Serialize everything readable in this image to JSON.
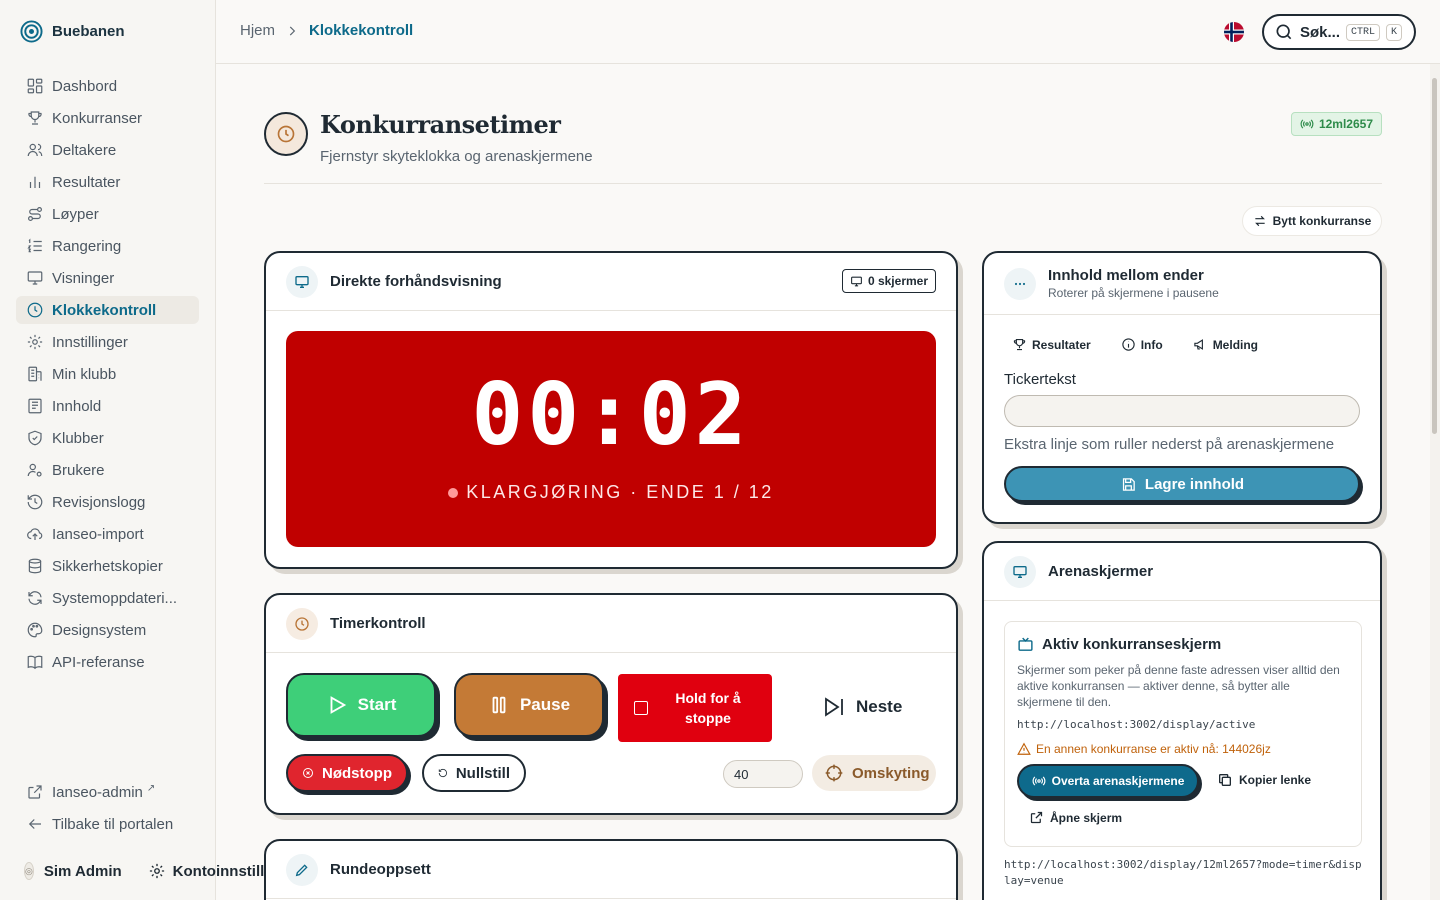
{
  "brand": {
    "name": "Buebanen"
  },
  "nav": {
    "items": [
      {
        "label": "Dashbord",
        "icon": "dashboard-icon"
      },
      {
        "label": "Konkurranser",
        "icon": "trophy-icon"
      },
      {
        "label": "Deltakere",
        "icon": "users-icon"
      },
      {
        "label": "Resultater",
        "icon": "bar-chart-icon"
      },
      {
        "label": "Løyper",
        "icon": "route-icon"
      },
      {
        "label": "Rangering",
        "icon": "list-ordered-icon"
      },
      {
        "label": "Visninger",
        "icon": "monitor-icon"
      },
      {
        "label": "Klokkekontroll",
        "icon": "clock-icon"
      },
      {
        "label": "Innstillinger",
        "icon": "gear-icon"
      },
      {
        "label": "Min klubb",
        "icon": "building-icon"
      },
      {
        "label": "Innhold",
        "icon": "newspaper-icon"
      },
      {
        "label": "Klubber",
        "icon": "shield-icon"
      },
      {
        "label": "Brukere",
        "icon": "user-gear-icon"
      },
      {
        "label": "Revisjonslogg",
        "icon": "history-icon"
      },
      {
        "label": "Ianseo-import",
        "icon": "cloud-upload-icon"
      },
      {
        "label": "Sikkerhetskopier",
        "icon": "database-icon"
      },
      {
        "label": "Systemoppdateri...",
        "icon": "refresh-icon"
      },
      {
        "label": "Designsystem",
        "icon": "palette-icon"
      },
      {
        "label": "API-referanse",
        "icon": "book-icon"
      }
    ],
    "active": "Klokkekontroll",
    "bottom": [
      {
        "label": "Ianseo-admin",
        "icon": "external-link-icon"
      },
      {
        "label": "Tilbake til portalen",
        "icon": "arrow-left-icon"
      }
    ]
  },
  "user": {
    "name": "Sim Admin",
    "account_label": "Kontoinnstilli"
  },
  "breadcrumb": {
    "home": "Hjem",
    "current": "Klokkekontroll"
  },
  "search": {
    "label": "Søk...",
    "kbd1": "CTRL",
    "kbd2": "K"
  },
  "page": {
    "title": "Konkurransetimer",
    "subtitle": "Fjernstyr skyteklokka og arenaskjermene",
    "competition_code": "12ml2657",
    "switch_button": "Bytt konkurranse"
  },
  "preview": {
    "title": "Direkte forhåndsvisning",
    "screens_badge": "0 skjermer",
    "time": "00:02",
    "phase": "KLARGJØRING · ENDE 1 / 12"
  },
  "timer": {
    "title": "Timerkontroll",
    "start": "Start",
    "pause": "Pause",
    "hold_stop_line1": "Hold for å",
    "hold_stop_line2": "stoppe",
    "next": "Neste",
    "emergency_stop": "Nødstopp",
    "reset": "Nullstill",
    "seconds_value": "40",
    "reshoot": "Omskyting"
  },
  "round_setup": {
    "title": "Rundeoppsett"
  },
  "between_ends": {
    "title": "Innhold mellom ender",
    "subtitle": "Roterer på skjermene i pausene",
    "tabs": [
      {
        "label": "Resultater",
        "icon": "trophy-icon"
      },
      {
        "label": "Info",
        "icon": "info-icon"
      },
      {
        "label": "Melding",
        "icon": "megaphone-icon"
      }
    ],
    "ticker_label": "Tickertekst",
    "ticker_value": "",
    "ticker_hint": "Ekstra linje som ruller nederst på arenaskjermene",
    "save_button": "Lagre innhold"
  },
  "arena": {
    "title": "Arenaskjermer",
    "active_title": "Aktiv konkurranseskjerm",
    "active_desc": "Skjermer som peker på denne faste adressen viser alltid den aktive konkurransen — aktiver denne, så bytter alle skjermene til den.",
    "active_url": "http://localhost:3002/display/active",
    "warning": "En annen konkurranse er aktiv nå: 144026jz",
    "takeover_button": "Overta arenaskjermene",
    "copy_link": "Kopier lenke",
    "open_screen": "Åpne skjerm",
    "venue_url": "http://localhost:3002/display/12ml2657?mode=timer&display=venue"
  },
  "colors": {
    "accent": "#0d6a8a",
    "clock_bg": "#c00000",
    "start": "#3ecf79",
    "pause": "#c47a36",
    "hold": "#e0000f",
    "emergency": "#e0252e",
    "save": "#3d94b5",
    "warning": "#c0620b",
    "live": "#2e8b4a"
  }
}
